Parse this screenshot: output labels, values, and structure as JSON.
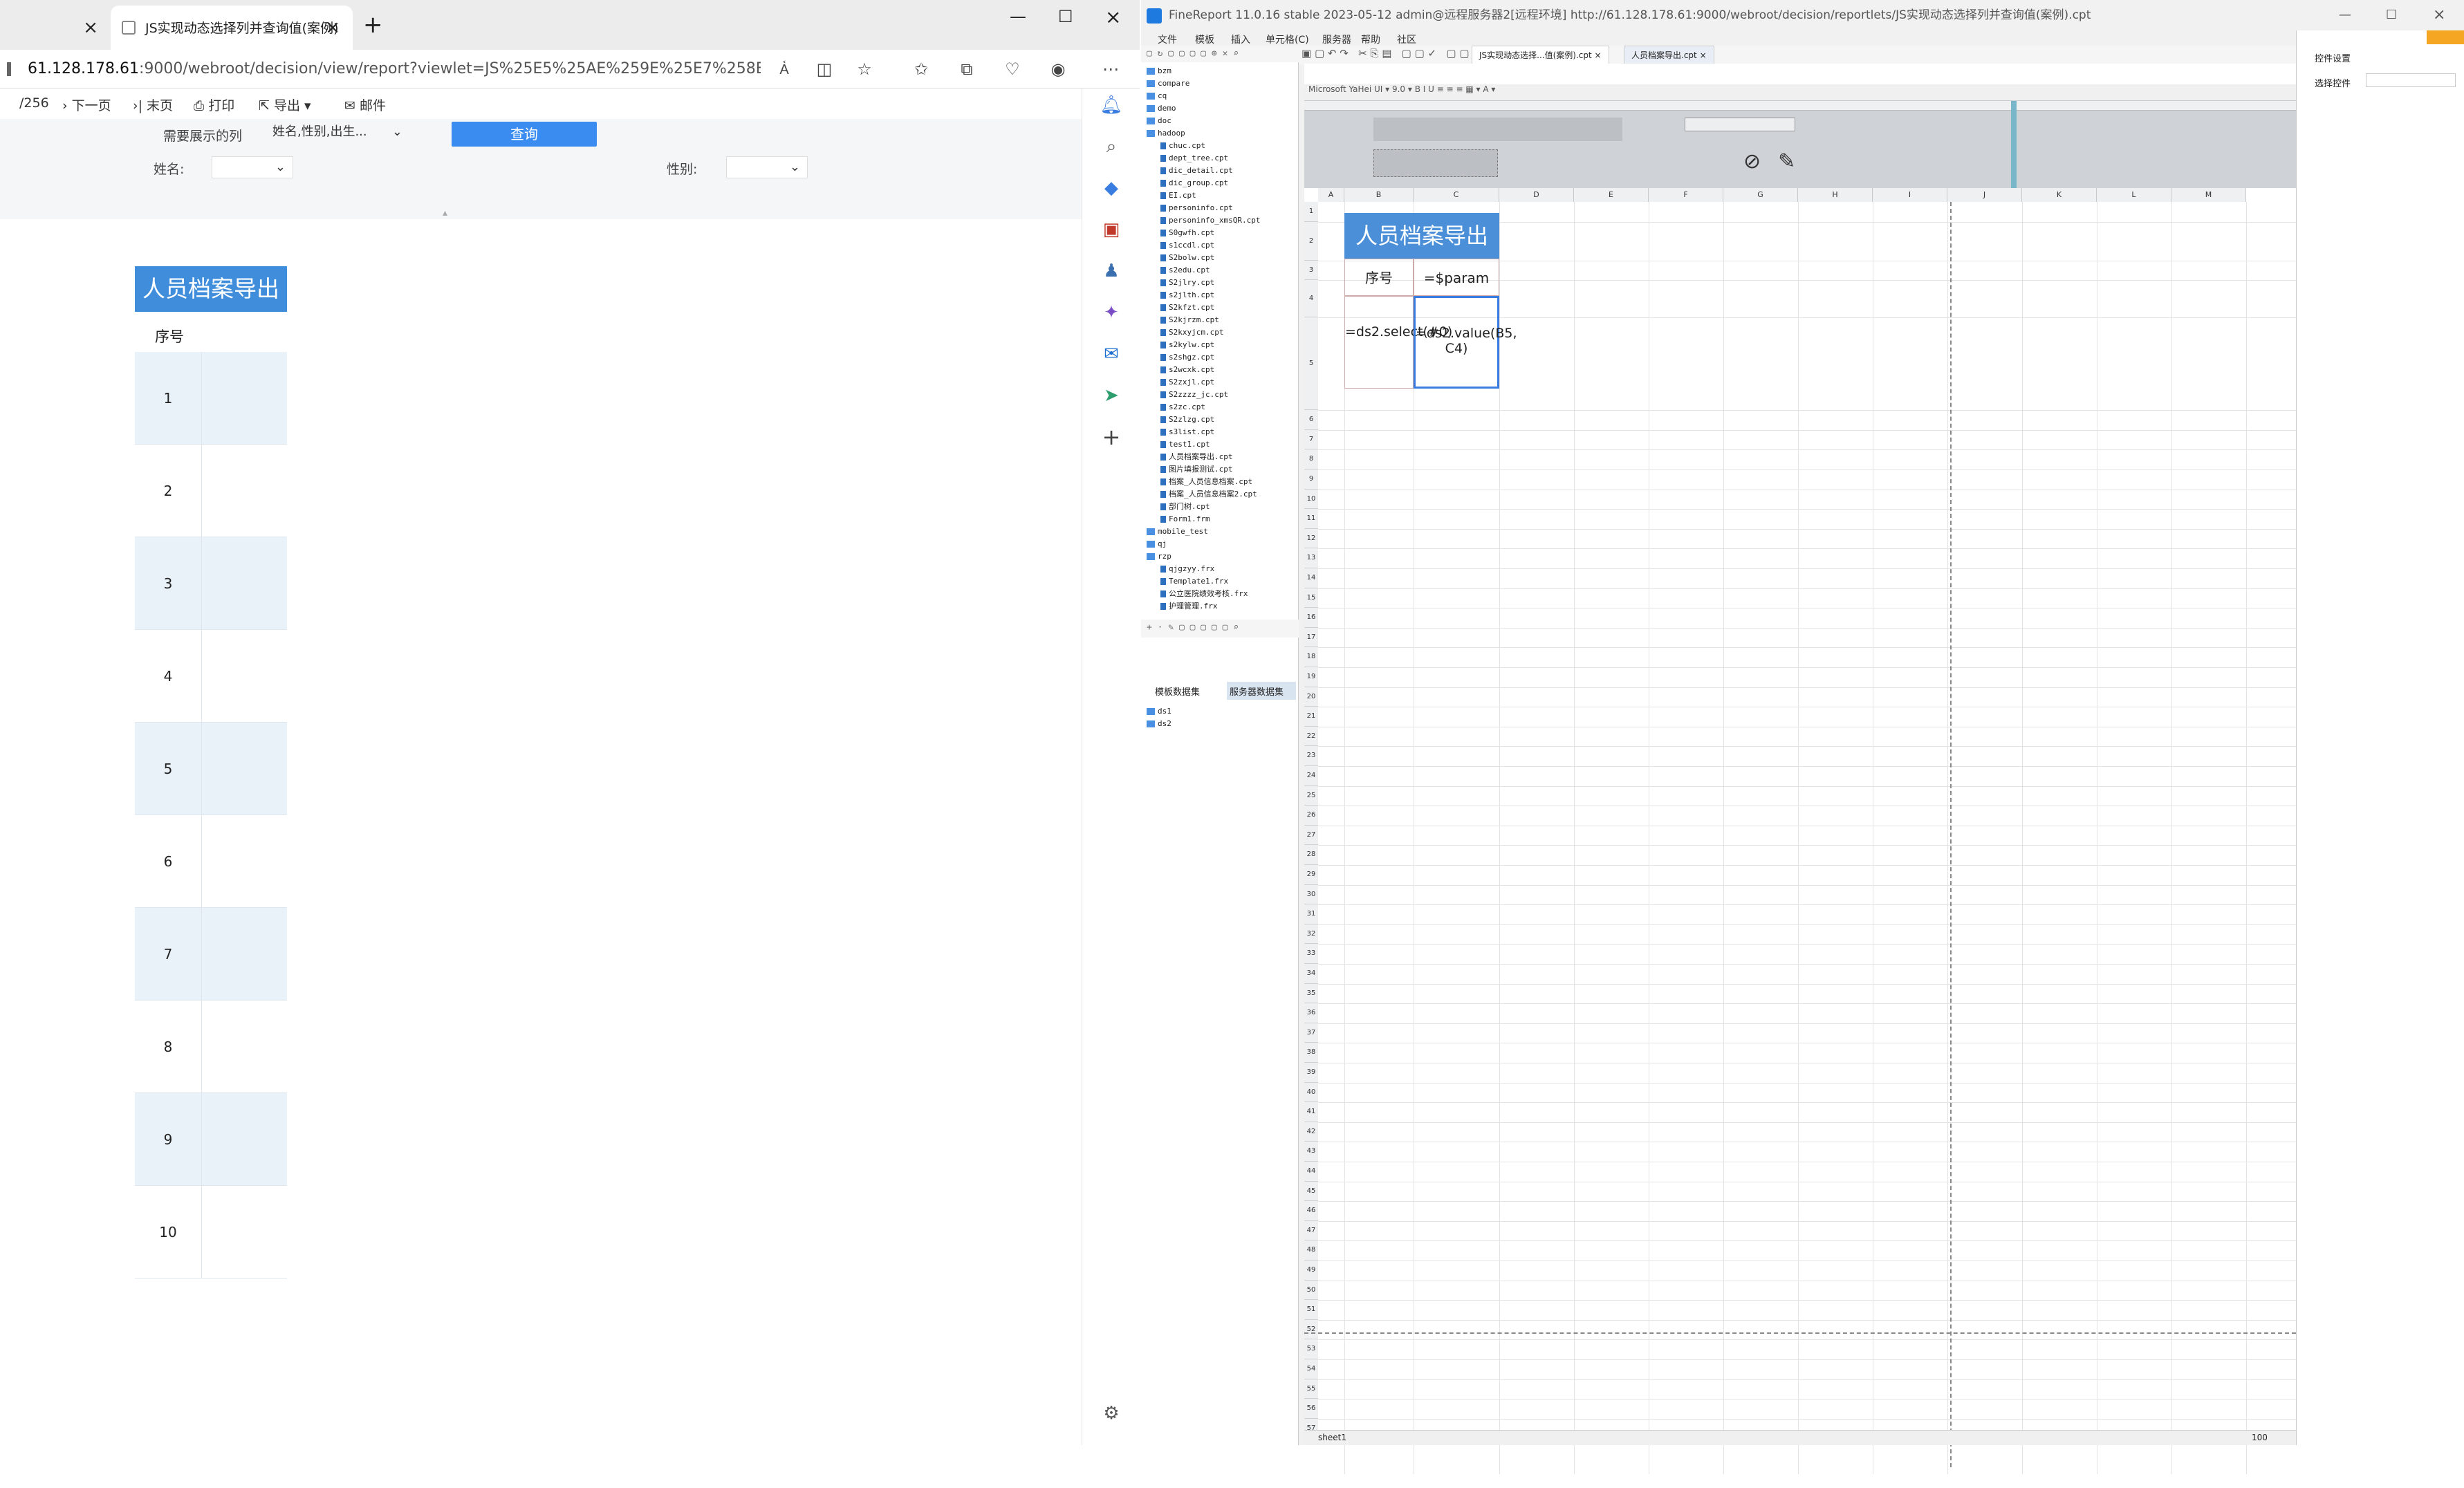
{
  "browser": {
    "tabs": [
      {
        "label": ""
      },
      {
        "label": "JS实现动态选择列并查询值(案例)"
      }
    ],
    "url_host": "61.128.178.61",
    "url_rest": ":9000/webroot/decision/view/report?viewlet=JS%25E5%25AE%259E%25E7%258E%25B0%25E5%25...",
    "toolbar": {
      "page_count": "/256",
      "next": "下一页",
      "last": "末页",
      "print": "打印",
      "export": "导出",
      "email": "邮件"
    },
    "params": {
      "columns_label": "需要展示的列",
      "columns_value": "姓名,性别,出生...",
      "query_button": "查询",
      "name_label": "姓名:",
      "gender_label": "性别:"
    },
    "report": {
      "title": "人员档案导出",
      "header_seq": "序号",
      "rows": [
        "1",
        "2",
        "3",
        "4",
        "5",
        "6",
        "7",
        "8",
        "9",
        "10"
      ]
    }
  },
  "designer": {
    "title": "FineReport 11.0.16 stable 2023-05-12 admin@远程服务器2[远程环境]    http://61.128.178.61:9000/webroot/decision/reportlets/JS实现动态选择列并查询值(案例).cpt",
    "menu": [
      "文件",
      "模板",
      "插入",
      "单元格(C)",
      "服务器",
      "帮助",
      "社区"
    ],
    "tabs": [
      "JS实现动态选择...值(案例).cpt",
      "人员档案导出.cpt"
    ],
    "tree": [
      {
        "type": "folder",
        "name": "bzm"
      },
      {
        "type": "folder",
        "name": "compare"
      },
      {
        "type": "folder",
        "name": "cq"
      },
      {
        "type": "folder",
        "name": "demo"
      },
      {
        "type": "folder",
        "name": "doc"
      },
      {
        "type": "folder",
        "name": "hadoop"
      },
      {
        "type": "file",
        "name": "chuc.cpt"
      },
      {
        "type": "file",
        "name": "dept_tree.cpt"
      },
      {
        "type": "file",
        "name": "dic_detail.cpt"
      },
      {
        "type": "file",
        "name": "dic_group.cpt"
      },
      {
        "type": "file",
        "name": "EI.cpt"
      },
      {
        "type": "file",
        "name": "personinfo.cpt"
      },
      {
        "type": "file",
        "name": "personinfo_xmsQR.cpt"
      },
      {
        "type": "file",
        "name": "S0gwfh.cpt"
      },
      {
        "type": "file",
        "name": "s1ccdl.cpt"
      },
      {
        "type": "file",
        "name": "S2bolw.cpt"
      },
      {
        "type": "file",
        "name": "s2edu.cpt"
      },
      {
        "type": "file",
        "name": "S2jlry.cpt"
      },
      {
        "type": "file",
        "name": "s2jlth.cpt"
      },
      {
        "type": "file",
        "name": "S2kfzt.cpt"
      },
      {
        "type": "file",
        "name": "S2kjrzm.cpt"
      },
      {
        "type": "file",
        "name": "S2kxyjcm.cpt"
      },
      {
        "type": "file",
        "name": "s2kylw.cpt"
      },
      {
        "type": "file",
        "name": "s2shgz.cpt"
      },
      {
        "type": "file",
        "name": "s2wcxk.cpt"
      },
      {
        "type": "file",
        "name": "S2zxjl.cpt"
      },
      {
        "type": "file",
        "name": "S2zzzz_jc.cpt"
      },
      {
        "type": "file",
        "name": "s2zc.cpt"
      },
      {
        "type": "file",
        "name": "S2zlzg.cpt"
      },
      {
        "type": "file",
        "name": "s3list.cpt"
      },
      {
        "type": "file",
        "name": "test1.cpt"
      },
      {
        "type": "file",
        "name": "人员档案导出.cpt"
      },
      {
        "type": "file",
        "name": "图片填报测试.cpt"
      },
      {
        "type": "file",
        "name": "档案_人员信息档案.cpt"
      },
      {
        "type": "file",
        "name": "档案_人员信息档案2.cpt"
      },
      {
        "type": "file",
        "name": "部门树.cpt"
      },
      {
        "type": "file",
        "name": "Form1.frm"
      },
      {
        "type": "folder",
        "name": "mobile_test"
      },
      {
        "type": "folder",
        "name": "qj"
      },
      {
        "type": "folder",
        "name": "rzp"
      },
      {
        "type": "file",
        "name": "qjgzyy.frx"
      },
      {
        "type": "file",
        "name": "Template1.frx"
      },
      {
        "type": "file",
        "name": "公立医院绩效考核.frx"
      },
      {
        "type": "file",
        "name": "护理管理.frx"
      }
    ],
    "dataset_tabs": [
      "模板数据集",
      "服务器数据集"
    ],
    "datasets": [
      "ds1",
      "ds2"
    ],
    "cells": {
      "title": "人员档案导出",
      "seq": "序号",
      "param": "=$param",
      "b5": "=ds2.select(#0)",
      "c5": "=ds2.value(B5, C4)"
    },
    "right_panel": {
      "title": "控件设置",
      "label": "选择控件"
    },
    "sheet_tab": "sheet1",
    "zoom": "100"
  }
}
